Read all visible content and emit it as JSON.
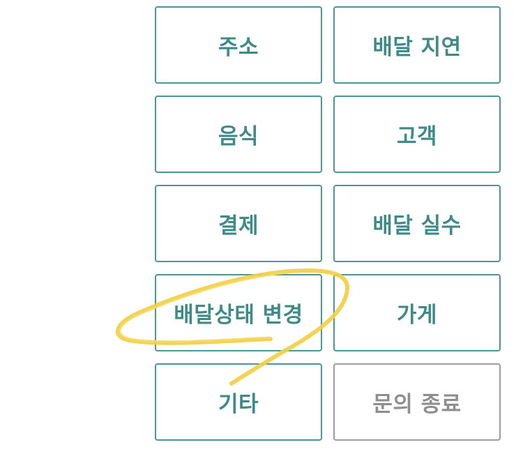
{
  "options": [
    {
      "label": "주소"
    },
    {
      "label": "배달 지연"
    },
    {
      "label": "음식"
    },
    {
      "label": "고객"
    },
    {
      "label": "결제"
    },
    {
      "label": "배달 실수"
    },
    {
      "label": "배달상태 변경"
    },
    {
      "label": "가게"
    },
    {
      "label": "기타"
    },
    {
      "label": "문의 종료"
    }
  ],
  "colors": {
    "accent": "#3d8a87",
    "accent_border": "#4d9593",
    "muted": "#8e8e8e",
    "muted_border": "#9c9c9c",
    "highlight": "#f2cf45"
  }
}
